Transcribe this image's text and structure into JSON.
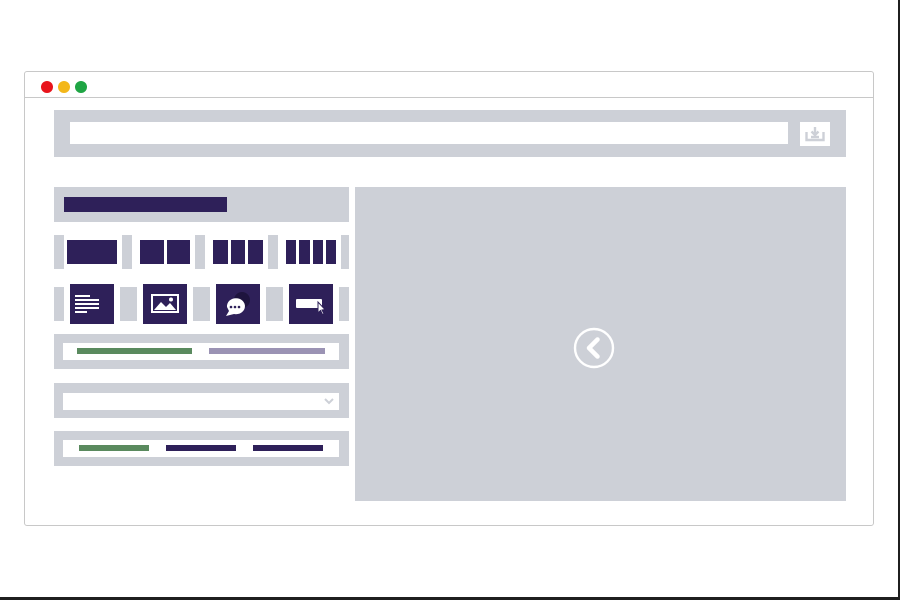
{
  "window": {
    "controls": [
      {
        "name": "close",
        "color": "#e8141c"
      },
      {
        "name": "minimize",
        "color": "#f3b71a"
      },
      {
        "name": "maximize",
        "color": "#1fa544"
      }
    ]
  },
  "address_bar": {
    "value": "",
    "placeholder": "",
    "download_icon": "download-tray-icon"
  },
  "sidebar": {
    "layout_options": [
      {
        "name": "one-column",
        "columns": 1
      },
      {
        "name": "two-columns",
        "columns": 2
      },
      {
        "name": "three-columns",
        "columns": 3
      },
      {
        "name": "four-columns",
        "columns": 4
      }
    ],
    "element_tools": [
      {
        "name": "text",
        "icon": "text-lines-icon"
      },
      {
        "name": "image",
        "icon": "image-icon"
      },
      {
        "name": "chat",
        "icon": "chat-bubble-icon"
      },
      {
        "name": "button",
        "icon": "button-cursor-icon"
      }
    ],
    "color_swatches_1": [
      "#5a8a5e",
      "#9b93b4"
    ],
    "dropdown": {
      "value": "",
      "icon": "chevron-down-icon"
    },
    "color_swatches_2": [
      "#5a8a5e",
      "#2e2059",
      "#2e2059"
    ]
  },
  "preview": {
    "nav_icon": "chevron-left-circle-icon",
    "background": "#cdd0d7"
  },
  "palette": {
    "panel_grey": "#cdd0d7",
    "accent_purple": "#2e2059",
    "white": "#ffffff"
  }
}
